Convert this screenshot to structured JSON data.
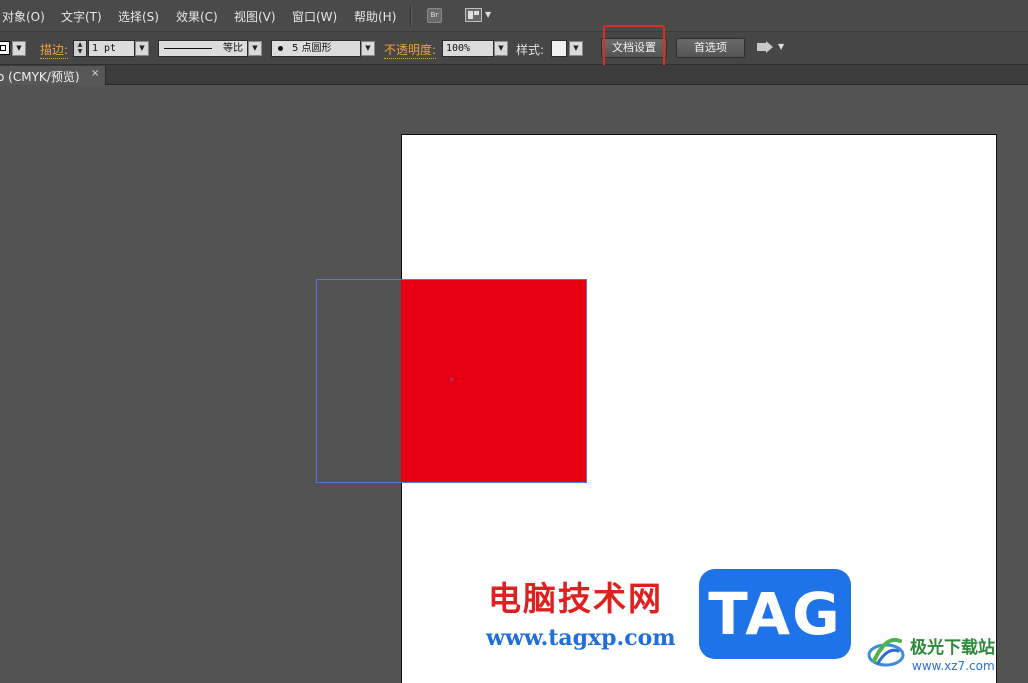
{
  "menu": {
    "items": [
      "对象(O)",
      "文字(T)",
      "选择(S)",
      "效果(C)",
      "视图(V)",
      "窗口(W)",
      "帮助(H)"
    ],
    "bridge_icon_text": "Br"
  },
  "control": {
    "stroke_label": "描边:",
    "stroke_weight": "1 pt",
    "stroke_profile": "等比",
    "brush": "5 点圆形",
    "opacity_label": "不透明度:",
    "opacity_value": "100%",
    "style_label": "样式:",
    "doc_setup_button": "文档设置",
    "preferences_button": "首选项"
  },
  "tab": {
    "title": "o (CMYK/预览)",
    "close": "×"
  },
  "canvas": {
    "fill_color": "#e60012",
    "selection_color": "#4f78e0",
    "center_mark": "×"
  },
  "watermark": {
    "site_name": "电脑技术网",
    "site_url": "www.tagxp.com",
    "tag_text": "TAG",
    "site2_name": "极光下载站",
    "site2_url": "www.xz7.com"
  }
}
